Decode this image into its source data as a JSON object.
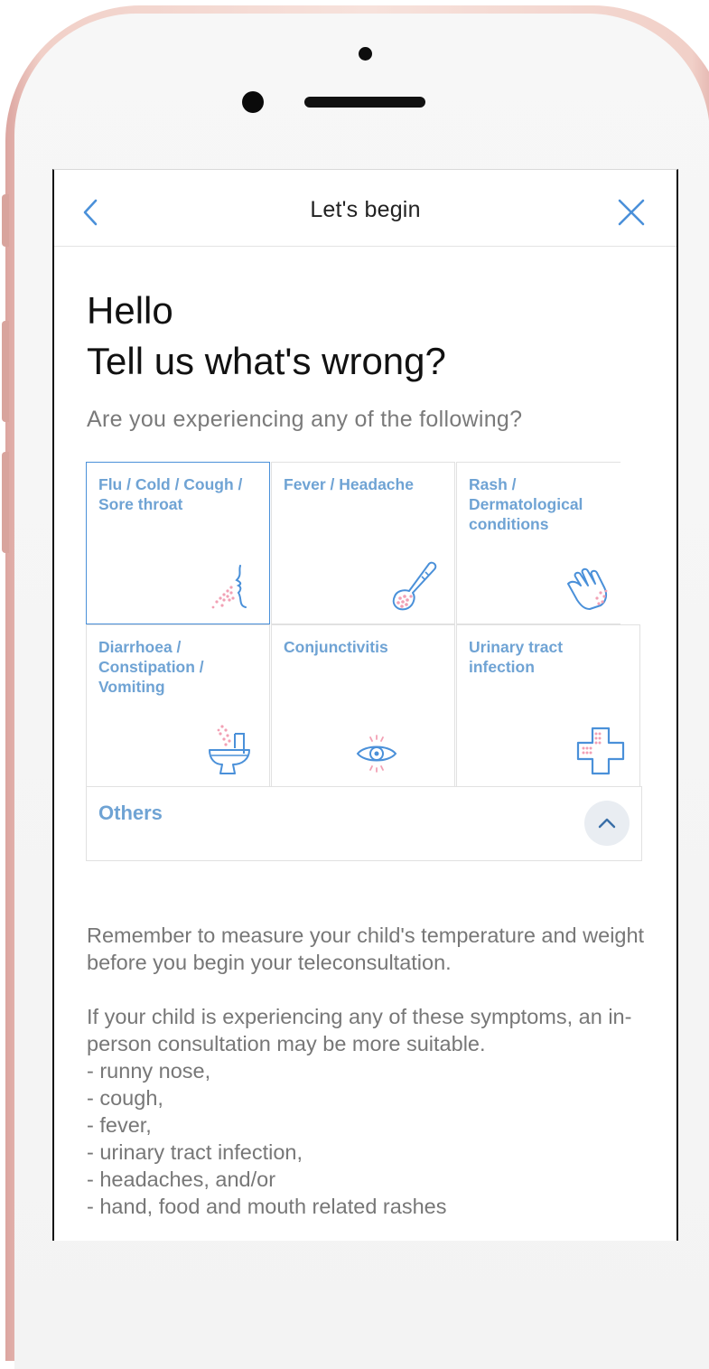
{
  "header": {
    "title": "Let's begin",
    "back_icon": "chevron-left-icon",
    "close_icon": "close-icon"
  },
  "greeting": {
    "line1": "Hello",
    "line2": "Tell us what's wrong?"
  },
  "question": "Are you experiencing any of the following?",
  "symptoms": [
    {
      "label": "Flu / Cold / Cough / Sore throat",
      "icon": "breath-face-icon",
      "selected": true
    },
    {
      "label": "Fever / Headache",
      "icon": "thermometer-icon",
      "selected": false
    },
    {
      "label": "Rash / Dermatological conditions",
      "icon": "hand-rash-icon",
      "selected": false
    },
    {
      "label": "Diarrhoea / Constipation / Vomiting",
      "icon": "toilet-icon",
      "selected": false
    },
    {
      "label": "Conjunctivitis",
      "icon": "eye-icon",
      "selected": false
    },
    {
      "label": "Urinary tract infection",
      "icon": "medical-cross-icon",
      "selected": false
    }
  ],
  "others": {
    "label": "Others",
    "toggle_icon": "chevron-up-icon"
  },
  "info": {
    "reminder": "Remember to measure your child's temperature and weight before you begin your teleconsultation.",
    "advice": "If your child is experiencing any of these symptoms, an in-person consultation may be more suitable.",
    "symptom_list": [
      "- runny nose,",
      "- cough,",
      "- fever,",
      "- urinary tract infection,",
      "- headaches, and/or",
      "- hand, food and mouth related rashes"
    ]
  },
  "colors": {
    "accent": "#4a90d9",
    "label_blue": "#6fa3d4",
    "icon_pink": "#f2a0b4",
    "text_gray": "#777777",
    "frame_rose": "#f1d0c8"
  }
}
